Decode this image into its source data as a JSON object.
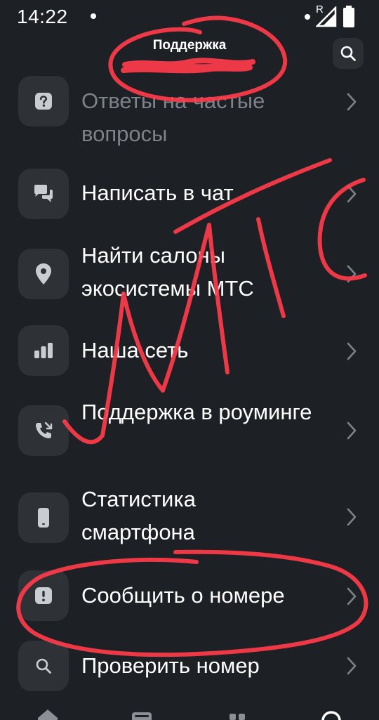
{
  "status_bar": {
    "time": "14:22",
    "network_letter": "R"
  },
  "header": {
    "title": "Поддержка"
  },
  "menu": {
    "items": [
      {
        "id": "faq",
        "label": "Ответы на частые вопросы",
        "icon": "question-icon",
        "muted": true
      },
      {
        "id": "chat",
        "label": "Написать в чат",
        "icon": "chat-bubbles-icon"
      },
      {
        "id": "salons",
        "label": "Найти салоны экосистемы МТС",
        "icon": "location-pin-icon"
      },
      {
        "id": "network",
        "label": "Наша сеть",
        "icon": "signal-bars-icon"
      },
      {
        "id": "roaming",
        "label": "Поддержка в роуминге",
        "icon": "phone-call-icon"
      },
      {
        "id": "stats",
        "label": "Статистика смартфона",
        "icon": "smartphone-icon"
      },
      {
        "id": "report",
        "label": "Сообщить о номере",
        "icon": "alert-icon"
      },
      {
        "id": "check",
        "label": "Проверить номер",
        "icon": "search-icon"
      }
    ]
  },
  "bottom_nav": {
    "items": [
      "home-icon",
      "wallet-icon",
      "apps-grid-icon",
      "headset-icon"
    ],
    "active_color": "#ffffff",
    "inactive_color": "#8a9096"
  },
  "colors": {
    "background": "#1d2024",
    "tile": "#2e3236",
    "scribble": "#ff3b4a",
    "muted_text": "#7d838a"
  }
}
